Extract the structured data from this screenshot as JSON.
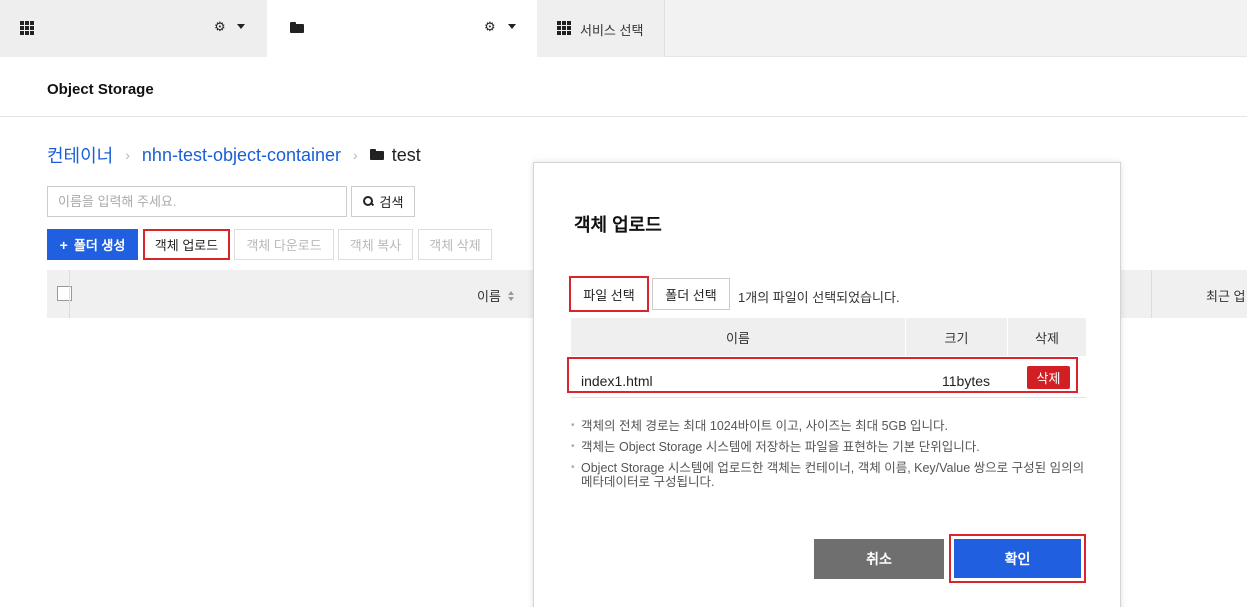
{
  "topbar": {
    "tab1": {
      "icon": "grid-icon",
      "settings_icon": "gear-icon"
    },
    "tab2": {
      "icon": "folder-icon",
      "settings_icon": "gear-icon"
    },
    "tab3": {
      "icon": "grid-icon",
      "label": "서비스 선택"
    }
  },
  "page": {
    "title": "Object Storage"
  },
  "breadcrumb": {
    "items": [
      "컨테이너",
      "nhn-test-object-container"
    ],
    "separator": "›",
    "current": "test"
  },
  "search": {
    "placeholder": "이름을 입력해 주세요.",
    "button_label": "검색"
  },
  "toolbar": {
    "create_folder": "폴더 생성",
    "upload": "객체 업로드",
    "download": "객체 다운로드",
    "copy": "객체 복사",
    "delete": "객체 삭제"
  },
  "table": {
    "columns": [
      "이름",
      "최근 업"
    ]
  },
  "modal": {
    "title": "객체 업로드",
    "file_select": "파일 선택",
    "folder_select": "폴더 선택",
    "selected_text": "1개의 파일이 선택되었습니다.",
    "columns": [
      "이름",
      "크기",
      "삭제"
    ],
    "rows": [
      {
        "name": "index1.html",
        "size": "11bytes",
        "action": "삭제"
      }
    ],
    "notes": [
      "객체의 전체 경로는 최대 1024바이트 이고, 사이즈는 최대 5GB 입니다.",
      "객체는 Object Storage 시스템에 저장하는 파일을 표현하는 기본 단위입니다.",
      "Object Storage 시스템에 업로드한 객체는 컨테이너, 객체 이름, Key/Value 쌍으로 구성된 임의의 메타데이터로 구성됩니다."
    ],
    "cancel": "취소",
    "confirm": "확인"
  },
  "colors": {
    "primary": "#1f5fe0",
    "danger": "#d21f24",
    "highlight": "#d9242c",
    "cancel": "#6f6f6f"
  }
}
